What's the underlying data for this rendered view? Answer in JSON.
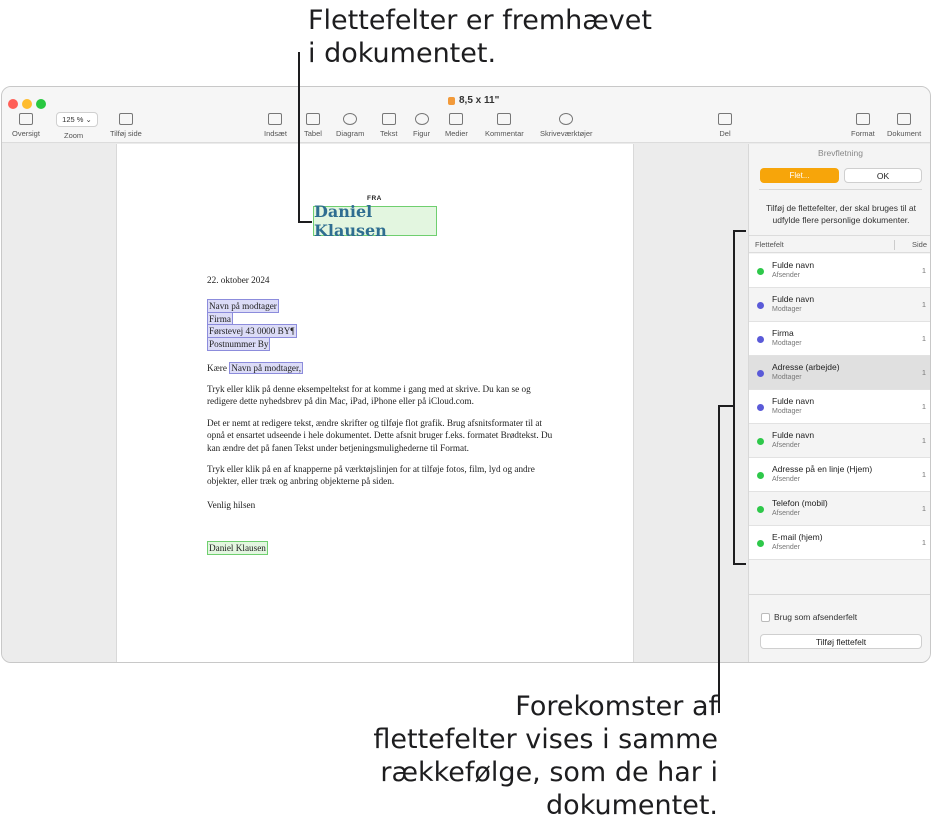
{
  "callouts": {
    "top": "Flettefelter er fremhævet i dokumentet.",
    "bottom": "Forekomster af flettefelter vises i samme rækkefølge, som de har i dokumentet."
  },
  "window": {
    "title": "8,5 x 11\""
  },
  "toolbar": {
    "oversigt": "Oversigt",
    "zoom_value": "125 % ⌄",
    "zoom": "Zoom",
    "tilfoj_side": "Tilføj side",
    "indsaet": "Indsæt",
    "tabel": "Tabel",
    "diagram": "Diagram",
    "tekst": "Tekst",
    "figur": "Figur",
    "medier": "Medier",
    "kommentar": "Kommentar",
    "skrivevaerktojer": "Skriveværktøjer",
    "del": "Del",
    "format": "Format",
    "dokument": "Dokument"
  },
  "document": {
    "fra": "FRA",
    "sender": "Daniel Klausen",
    "date": "22. oktober 2024",
    "recipient_name": "Navn på modtager",
    "company": "Firma",
    "street": "Førstevej 43 0000 BY¶",
    "postcode": "Postnummer By",
    "greeting_prefix": "Kære ",
    "greeting_name": "Navn på modtager,",
    "p1": "Tryk eller klik på denne eksempeltekst for at komme i gang med at skrive. Du kan se og redigere dette nyhedsbrev på din Mac, iPad, iPhone eller på iCloud.com.",
    "p2": "Det er nemt at redigere tekst, ændre skrifter og tilføje flot grafik. Brug afsnitsformater til at opnå et ensartet udseende i hele dokumentet. Dette afsnit bruger f.eks. formatet Brødtekst. Du kan ændre det på fanen Tekst under betjeningsmulighederne til Format.",
    "p3": "Tryk eller klik på en af knapperne på værktøjslinjen for at tilføje fotos, film, lyd og andre objekter, eller træk og anbring objekterne på siden.",
    "closing": "Venlig hilsen",
    "signature": "Daniel Klausen"
  },
  "sidebar": {
    "title": "Brevfletning",
    "flet_button": "Flet...",
    "ok_button": "OK",
    "description": "Tilføj de flettefelter, der skal bruges til at udfylde flere personlige dokumenter.",
    "col_field": "Flettefelt",
    "col_page": "Side",
    "rows": [
      {
        "name": "Fulde navn",
        "sub": "Afsender",
        "page": "1",
        "color": "#2ec84a"
      },
      {
        "name": "Fulde navn",
        "sub": "Modtager",
        "page": "1",
        "color": "#5a5ad8"
      },
      {
        "name": "Firma",
        "sub": "Modtager",
        "page": "1",
        "color": "#5a5ad8"
      },
      {
        "name": "Adresse (arbejde)",
        "sub": "Modtager",
        "page": "1",
        "color": "#5a5ad8"
      },
      {
        "name": "Fulde navn",
        "sub": "Modtager",
        "page": "1",
        "color": "#5a5ad8"
      },
      {
        "name": "Fulde navn",
        "sub": "Afsender",
        "page": "1",
        "color": "#2ec84a"
      },
      {
        "name": "Adresse på en linje (Hjem)",
        "sub": "Afsender",
        "page": "1",
        "color": "#2ec84a"
      },
      {
        "name": "Telefon (mobil)",
        "sub": "Afsender",
        "page": "1",
        "color": "#2ec84a"
      },
      {
        "name": "E-mail (hjem)",
        "sub": "Afsender",
        "page": "1",
        "color": "#2ec84a"
      }
    ],
    "use_as_sender": "Brug som afsenderfelt",
    "add_field": "Tilføj flettefelt"
  }
}
